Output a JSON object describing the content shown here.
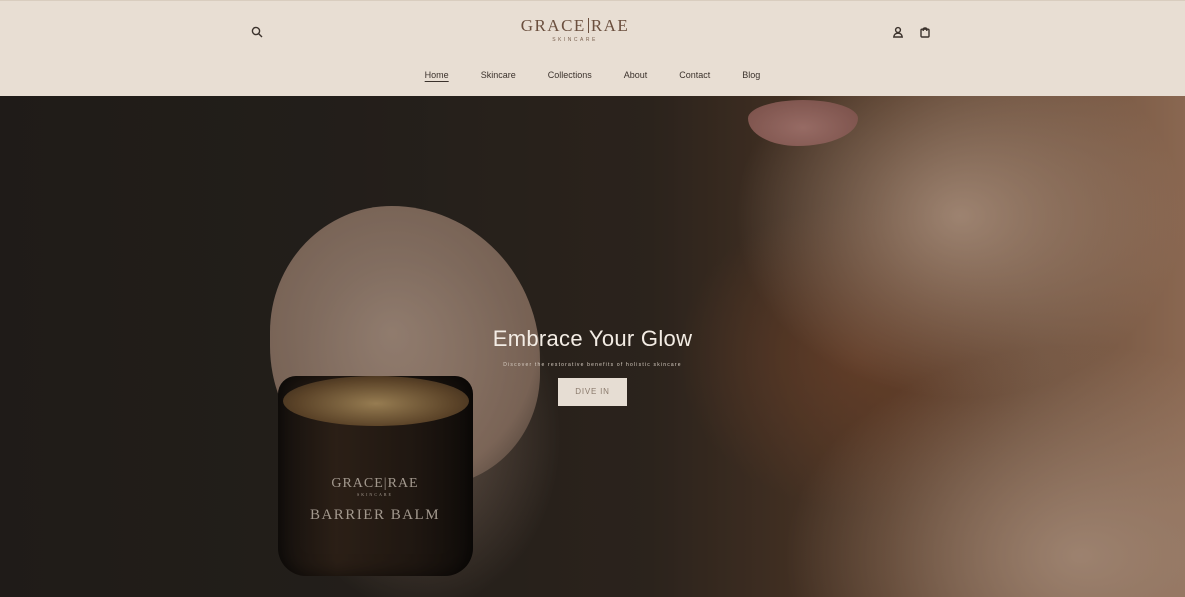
{
  "header": {
    "logo": {
      "main_left": "GRACE",
      "main_right": "RAE",
      "sub": "SKINCARE"
    },
    "icons": {
      "search": "search-icon",
      "account": "user-icon",
      "cart": "bag-icon"
    }
  },
  "nav": {
    "items": [
      {
        "label": "Home",
        "active": true
      },
      {
        "label": "Skincare"
      },
      {
        "label": "Collections"
      },
      {
        "label": "About"
      },
      {
        "label": "Contact"
      },
      {
        "label": "Blog"
      }
    ]
  },
  "hero": {
    "title": "Embrace Your Glow",
    "subtitle": "Discover the restorative benefits of holistic skincare",
    "button_label": "DIVE IN",
    "jar": {
      "brand": "GRACE|RAE",
      "brand_sub": "SKINCARE",
      "product": "BARRIER BALM"
    }
  },
  "colors": {
    "header_bg": "#e8ded3",
    "logo": "#6b4f3e",
    "button_bg": "#e6ddd3",
    "hero_text": "#f3ece4"
  }
}
